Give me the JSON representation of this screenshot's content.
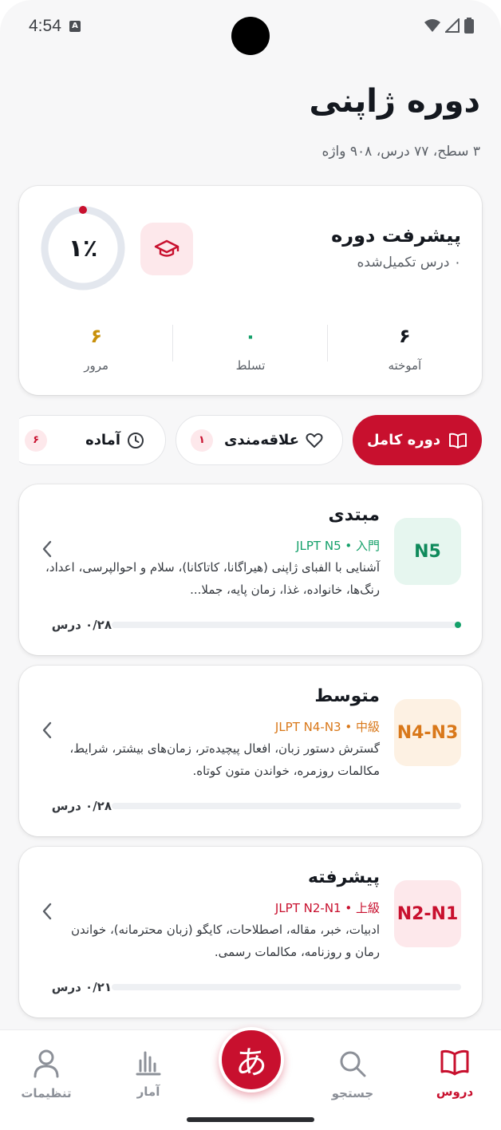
{
  "status_bar": {
    "time": "4:54",
    "badge": "A"
  },
  "header": {
    "title": "دوره ژاپنی",
    "subtitle": "۳ سطح، ۷۷ درس، ۹۰۸ واژه"
  },
  "progress_card": {
    "title": "پیشرفت دوره",
    "subtitle": "۰ درس تکمیل‌شده",
    "percent_label": "۱٪",
    "percent_value": 1,
    "icon": "graduation-cap-icon",
    "stats": [
      {
        "value": "۶",
        "label": "آموخته",
        "color": "#14181f"
      },
      {
        "value": "۰",
        "label": "تسلط",
        "color": "#14a06a"
      },
      {
        "value": "۶",
        "label": "مرور",
        "color": "#c8900a"
      }
    ]
  },
  "chips": {
    "full_course": "دوره کامل",
    "favorites": "علاقه‌مندی",
    "favorites_count": "۱",
    "ready": "آماده",
    "ready_count": "۶"
  },
  "levels": [
    {
      "badge": "N5",
      "badge_color": "#0f8a5b",
      "badge_bg": "#e6f6ef",
      "title": "مبتدی",
      "tag": "JLPT N5 • 入門",
      "tag_color": "#14a06a",
      "description": "آشنایی با الفبای ژاپنی (هیراگانا، کاتاکانا)، سلام و احوالپرسی، اعداد، رنگ‌ها، خانواده، غذا، زمان پایه، جملا...",
      "progress_label": "۰/۲۸ درس",
      "progress": 0
    },
    {
      "badge": "N4-N3",
      "badge_color": "#d9781a",
      "badge_bg": "#fdf1e3",
      "title": "متوسط",
      "tag": "JLPT N4-N3 • 中級",
      "tag_color": "#d9781a",
      "description": "گسترش دستور زبان، افعال پیچیده‌تر، زمان‌های بیشتر، شرایط، مکالمات روزمره، خواندن متون کوتاه.",
      "progress_label": "۰/۲۸ درس",
      "progress": 0
    },
    {
      "badge": "N2-N1",
      "badge_color": "#c8102e",
      "badge_bg": "#fde8eb",
      "title": "پیشرفته",
      "tag": "JLPT N2-N1 • 上級",
      "tag_color": "#c8102e",
      "description": "ادبیات، خبر، مقاله، اصطلاحات، کایگو (زبان محترمانه)، خواندن رمان و روزنامه، مکالمات رسمی.",
      "progress_label": "۰/۲۱ درس",
      "progress": 0
    }
  ],
  "bottom_nav": {
    "lessons": "دروس",
    "search": "جستجو",
    "fab": "あ",
    "stats": "آمار",
    "settings": "تنظیمات"
  },
  "colors": {
    "accent": "#c8102e"
  }
}
